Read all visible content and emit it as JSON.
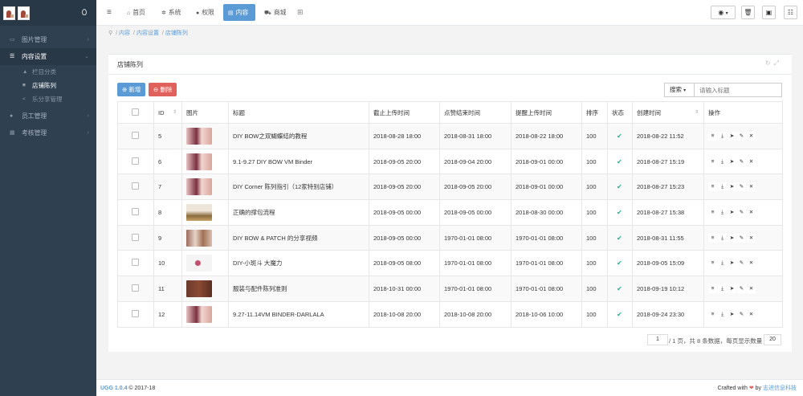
{
  "topbar": {
    "menu_icon": "hamburger-icon",
    "tabs": [
      {
        "label": "首页",
        "icon": "home-icon"
      },
      {
        "label": "系统",
        "icon": "gear-icon"
      },
      {
        "label": "权限",
        "icon": "user-icon"
      },
      {
        "label": "内容",
        "icon": "list-icon"
      },
      {
        "label": "商城",
        "icon": "cart-icon"
      }
    ],
    "grid_icon": "apps-grid-icon",
    "right_buttons": [
      "eye-icon",
      "trash-icon",
      "fullscreen-icon",
      "menu-list-icon"
    ]
  },
  "sidebar": {
    "items": [
      {
        "label": "图片管理",
        "icon": "image-icon"
      },
      {
        "label": "内容设置",
        "icon": "sliders-icon"
      },
      {
        "label": "员工管理",
        "icon": "user-icon"
      },
      {
        "label": "考核管理",
        "icon": "table-icon"
      }
    ],
    "subitems": [
      {
        "label": "栏目分类",
        "icon": "warning-icon"
      },
      {
        "label": "店铺陈列",
        "icon": "list-icon"
      },
      {
        "label": "乐分享管理",
        "icon": "share-icon"
      }
    ]
  },
  "breadcrumb": {
    "icon": "map-pin-icon",
    "items": [
      "内容",
      "内容设置",
      "店铺陈列"
    ]
  },
  "panel": {
    "title": "店铺陈列",
    "add_label": "新增",
    "delete_label": "删除",
    "search_select": "搜索",
    "search_placeholder": "请输入标题"
  },
  "table": {
    "headers": [
      "ID",
      "图片",
      "标题",
      "截止上传时间",
      "点赞结束时间",
      "提醒上传时间",
      "排序",
      "状态",
      "创建时间",
      "操作"
    ],
    "rows": [
      {
        "id": "5",
        "title": "DIY BOW之双蝴蝶结的教程",
        "deadline": "2018-08-28 18:00",
        "like_end": "2018-08-31 18:00",
        "remind": "2018-08-22 18:00",
        "sort": "100",
        "created": "2018-08-22 11:52",
        "thumb": "pink"
      },
      {
        "id": "6",
        "title": "9.1-9.27 DIY BOW VM Binder",
        "deadline": "2018-09-05 20:00",
        "like_end": "2018-09-04 20:00",
        "remind": "2018-09-01 00:00",
        "sort": "100",
        "created": "2018-08-27 15:19",
        "thumb": "pink"
      },
      {
        "id": "7",
        "title": "DIY Corner 陈列指引（12家特别店铺）",
        "deadline": "2018-09-05 20:00",
        "like_end": "2018-09-05 20:00",
        "remind": "2018-09-01 00:00",
        "sort": "100",
        "created": "2018-08-27 15:23",
        "thumb": "pink"
      },
      {
        "id": "8",
        "title": "正确的撑包流程",
        "deadline": "2018-09-05 00:00",
        "like_end": "2018-09-05 00:00",
        "remind": "2018-08-30 00:00",
        "sort": "100",
        "created": "2018-08-27 15:38",
        "thumb": "bag"
      },
      {
        "id": "9",
        "title": "DIY BOW & PATCH 的分享视频",
        "deadline": "2018-09-05 00:00",
        "like_end": "1970-01-01 08:00",
        "remind": "1970-01-01 08:00",
        "sort": "100",
        "created": "2018-08-31 11:55",
        "thumb": "mixed"
      },
      {
        "id": "10",
        "title": "DIY-小斑斗 大魔力",
        "deadline": "2018-09-05 08:00",
        "like_end": "1970-01-01 08:00",
        "remind": "1970-01-01 08:00",
        "sort": "100",
        "created": "2018-09-05 15:09",
        "thumb": "white"
      },
      {
        "id": "11",
        "title": "服装与配件陈列准则",
        "deadline": "2018-10-31 00:00",
        "like_end": "1970-01-01 08:00",
        "remind": "1970-01-01 08:00",
        "sort": "100",
        "created": "2018-09-19 10:12",
        "thumb": "brown"
      },
      {
        "id": "12",
        "title": "9.27-11.14VM BINDER-DARLALA",
        "deadline": "2018-10-08 20:00",
        "like_end": "2018-10-08 20:00",
        "remind": "2018-10-06 10:00",
        "sort": "100",
        "created": "2018-09-24 23:30",
        "thumb": "pink"
      }
    ],
    "status_icon": "check-icon",
    "op_icons": [
      "list-icon",
      "download-icon",
      "send-icon",
      "edit-icon",
      "close-icon"
    ]
  },
  "pager": {
    "current": "1",
    "summary": "/ 1 页，共 8 条数据，每页显示数量",
    "page_size": "20"
  },
  "footer": {
    "brand": "UGG 1.0.4",
    "copyright": "© 2017-18",
    "crafted": "Crafted with",
    "by": "by",
    "company": "志进信息科技"
  },
  "colors": {
    "sidebar_bg": "#2f4050",
    "primary": "#5b9bd5",
    "danger": "#e0615c",
    "success": "#1ab394"
  }
}
